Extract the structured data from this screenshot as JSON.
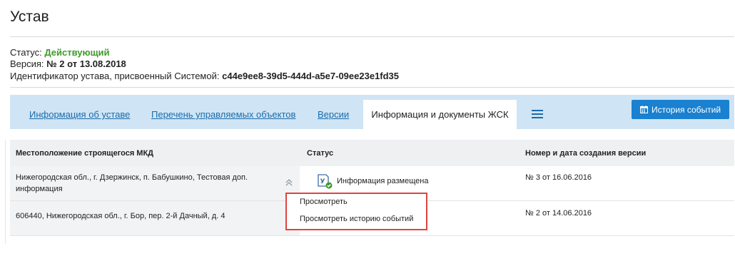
{
  "page": {
    "title": "Устав"
  },
  "meta": {
    "status_label": "Статус:",
    "status_value": "Действующий",
    "version_label": "Версия:",
    "version_value": "№ 2 от 13.08.2018",
    "id_label": "Идентификатор устава, присвоенный Системой:",
    "id_value": "c44e9ee8-39d5-444d-a5e7-09ee23e1fd35"
  },
  "tabs": [
    {
      "label": "Информация об уставе"
    },
    {
      "label": "Перечень управляемых объектов"
    },
    {
      "label": "Версии"
    },
    {
      "label": "Информация и документы ЖСК",
      "active": true
    }
  ],
  "toolbar": {
    "history_button": "История событий",
    "history_icon": "calendar-icon",
    "menu_icon": "hamburger-icon"
  },
  "table": {
    "headers": [
      "Местоположение строящегося МКД",
      "Статус",
      "Номер и дата создания версии"
    ],
    "rows": [
      {
        "location": "Нижегородская обл., г. Дзержинск, п. Бабушкино, Тестовая доп. информация",
        "status": "Информация размещена",
        "version": "№ 3 от 16.06.2016"
      },
      {
        "location": "606440, Нижегородская обл., г. Бор, пер. 2-й Дачный, д. 4",
        "status": "",
        "version": "№ 2 от 14.06.2016"
      }
    ]
  },
  "context_menu": {
    "items": [
      "Просмотреть",
      "Просмотреть историю событий"
    ]
  },
  "colors": {
    "accent": "#1a80d0",
    "status_active": "#3d9a2b",
    "highlight": "#e0443c",
    "tabbar_bg": "#cfe4f4"
  }
}
